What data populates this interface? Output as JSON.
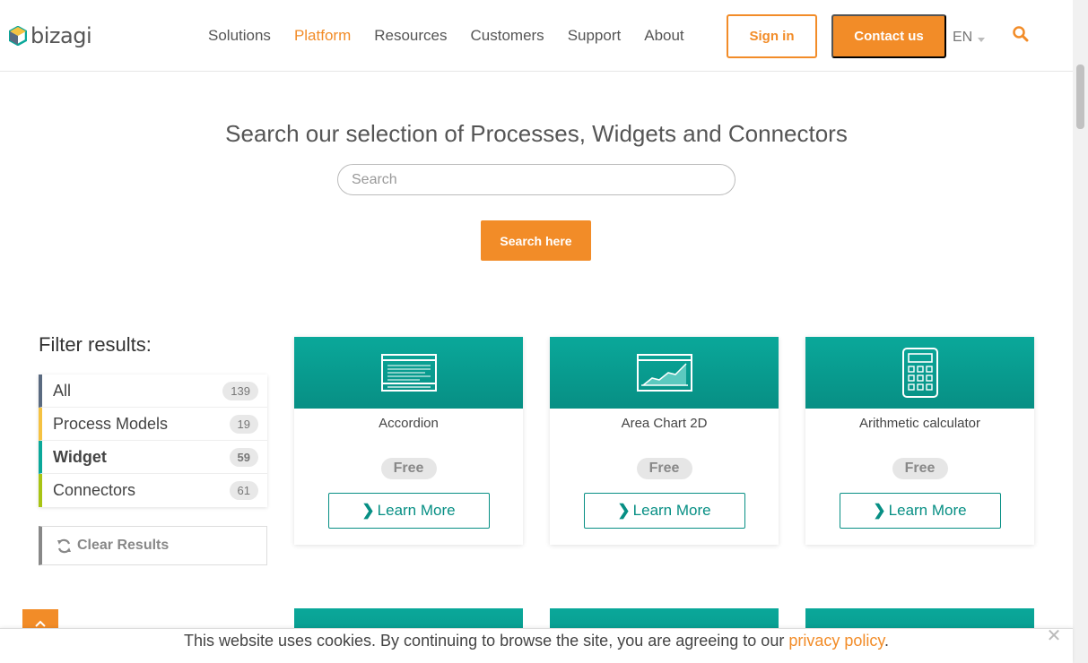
{
  "header": {
    "logo_text": "bizagi",
    "nav": [
      {
        "label": "Solutions",
        "active": false
      },
      {
        "label": "Platform",
        "active": true
      },
      {
        "label": "Resources",
        "active": false
      },
      {
        "label": "Customers",
        "active": false
      },
      {
        "label": "Support",
        "active": false
      },
      {
        "label": "About",
        "active": false
      }
    ],
    "sign_in": "Sign in",
    "contact": "Contact us",
    "language": "EN"
  },
  "search": {
    "title": "Search our selection of Processes, Widgets and Connectors",
    "placeholder": "Search",
    "button": "Search here"
  },
  "filter": {
    "title": "Filter results:",
    "items": [
      {
        "label": "All",
        "count": "139",
        "color": "#5a6a80",
        "selected": false
      },
      {
        "label": "Process Models",
        "count": "19",
        "color": "#f5c242",
        "selected": false
      },
      {
        "label": "Widget",
        "count": "59",
        "color": "#0aa89a",
        "selected": true
      },
      {
        "label": "Connectors",
        "count": "61",
        "color": "#a8c414",
        "selected": false
      }
    ],
    "clear": "Clear Results"
  },
  "cards": [
    {
      "title": "Accordion",
      "price": "Free",
      "cta": "Learn More",
      "icon": "accordion-icon"
    },
    {
      "title": "Area Chart 2D",
      "price": "Free",
      "cta": "Learn More",
      "icon": "area-chart-icon"
    },
    {
      "title": "Arithmetic calculator",
      "price": "Free",
      "cta": "Learn More",
      "icon": "calculator-icon"
    }
  ],
  "cookie": {
    "text": "This website uses cookies. By continuing to browse the site, you are agreeing to our ",
    "link": "privacy policy",
    "end": "."
  },
  "colors": {
    "accent": "#f28c28",
    "teal": "#0aa89a"
  }
}
